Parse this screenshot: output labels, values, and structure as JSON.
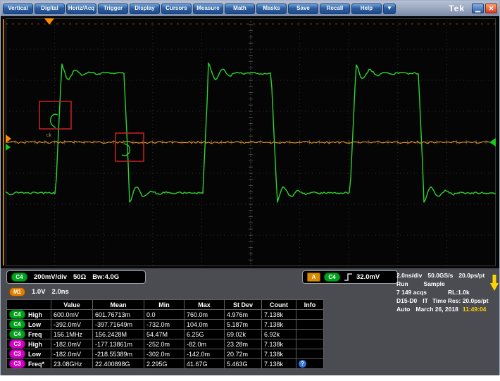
{
  "window": {
    "logo": "Tek",
    "minimize_icon": "▁",
    "close_icon": "✕"
  },
  "menu": {
    "items": [
      "Vertical",
      "Digital",
      "Horiz/Acq",
      "Trigger",
      "Display",
      "Cursors",
      "Measure",
      "Math",
      "Masks",
      "Save",
      "Recall",
      "Help"
    ],
    "overflow": "▼"
  },
  "readouts": {
    "c4": {
      "badge": "C4",
      "scale": "200mV/div",
      "termination": "50Ω",
      "bandwidth": "Bw:4.0G"
    },
    "m1": {
      "badge": "M1",
      "scale": "1.0V",
      "timebase": "2.0ns"
    }
  },
  "trigger": {
    "badge": "A",
    "source": "C4",
    "level": "32.0mV"
  },
  "horizontal": {
    "timebase": "2.0ns/div",
    "sample_rate": "50.0GS/s",
    "resolution": "20.0ps/pt",
    "run_state": "Run",
    "acq_mode": "Sample",
    "acqs": "7 149 acqs",
    "record_length": "RL:1.0k",
    "digital": "D15-D0",
    "interp": "IT",
    "time_res": "Time Res: 20.0ps/pt",
    "trigger_mode": "Auto",
    "date": "March 26, 2018",
    "time": "11:49:04"
  },
  "measurements": {
    "headers": {
      "value": "Value",
      "mean": "Mean",
      "min": "Min",
      "max": "Max",
      "stdev": "St Dev",
      "count": "Count",
      "info": "Info"
    },
    "rows": [
      {
        "badge": "C4",
        "name": "High",
        "value": "600.0mV",
        "mean": "601.76713m",
        "min": "0.0",
        "max": "760.0m",
        "stdev": "4.976m",
        "count": "7.138k",
        "info": ""
      },
      {
        "badge": "C4",
        "name": "Low",
        "value": "-392.0mV",
        "mean": "-397.71649m",
        "min": "-732.0m",
        "max": "104.0m",
        "stdev": "5.187m",
        "count": "7.138k",
        "info": ""
      },
      {
        "badge": "C4",
        "name": "Freq",
        "value": "156.1MHz",
        "mean": "156.2428M",
        "min": "54.47M",
        "max": "6.25G",
        "stdev": "69.02k",
        "count": "6.92k",
        "info": ""
      },
      {
        "badge": "C3",
        "name": "High",
        "value": "-182.0mV",
        "mean": "-177.13861m",
        "min": "-252.0m",
        "max": "-82.0m",
        "stdev": "23.28m",
        "count": "7.138k",
        "info": ""
      },
      {
        "badge": "C3",
        "name": "Low",
        "value": "-182.0mV",
        "mean": "-218.55389m",
        "min": "-302.0m",
        "max": "-142.0m",
        "stdev": "20.72m",
        "count": "7.138k",
        "info": ""
      },
      {
        "badge": "C3",
        "name": "Freq*",
        "value": "23.08GHz",
        "mean": "22.400898G",
        "min": "2.295G",
        "max": "41.67G",
        "stdev": "5.463G",
        "count": "7.138k",
        "info": "?"
      }
    ]
  },
  "annotations": {
    "glitch_label": "ck"
  },
  "chart_data": {
    "type": "line",
    "title": "Oscilloscope graticule: C4 square wave with ringing, flat trigger-level baseline, two red mask-violation boxes",
    "x_axis": {
      "scale_per_div": "2.0ns",
      "divisions": 10
    },
    "y_axis": {
      "scale_per_div": "200mV (C4)",
      "divisions": 8
    },
    "series": [
      {
        "name": "C4",
        "color": "#2fd42f",
        "shape": "square_wave_with_ringing",
        "high": "600mV",
        "low": "-392mV",
        "frequency": "156.1MHz",
        "duty_cycle_pct": 46
      },
      {
        "name": "baseline",
        "color": "#ffa019",
        "shape": "flat_noise",
        "level": "32.0mV (trigger level)"
      }
    ],
    "annotations": [
      {
        "type": "violation_box",
        "color": "#cc2222",
        "x_div": 0.9,
        "y_div": 2.8
      },
      {
        "type": "violation_box",
        "color": "#cc2222",
        "x_div": 2.4,
        "y_div": 3.9
      }
    ],
    "grid": "dotted graticule, bright center crosshair"
  }
}
